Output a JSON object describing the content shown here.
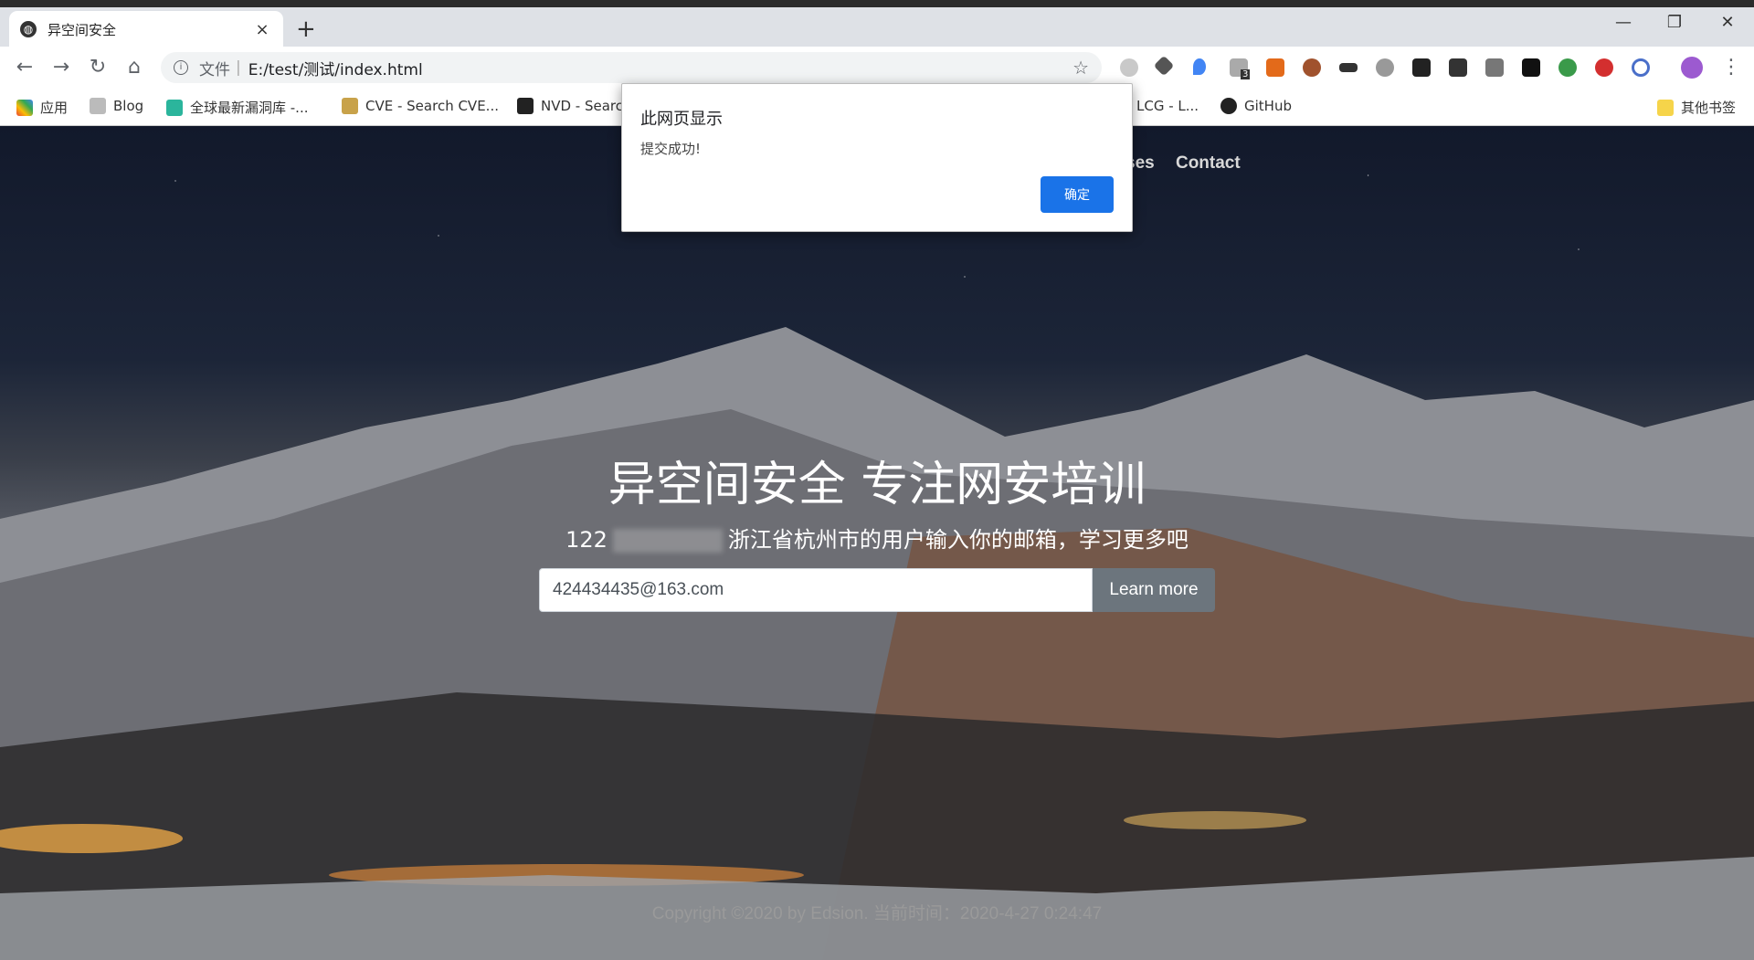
{
  "browser": {
    "tab_title": "异空间安全",
    "url_scheme": "文件",
    "url": "E:/test/测试/index.html",
    "extension_badge": "3",
    "bookmarks": [
      "应用",
      "Blog",
      "全球最新漏洞库 -...",
      "CVE - Search CVE...",
      "NVD - Searc",
      "LCG - L...",
      "GitHub",
      "其他书签"
    ]
  },
  "page": {
    "nav_partial": [
      "ses",
      "Contact"
    ],
    "hero_title": "异空间安全 专注网安培训",
    "hero_sub_prefix": "122",
    "hero_sub_suffix": "浙江省杭州市的用户输入你的邮箱，学习更多吧",
    "email_value": "424434435@163.com",
    "learn_more": "Learn more",
    "footer": "Copyright ©2020 by Edsion. 当前时间：2020-4-27 0:24:47"
  },
  "dialog": {
    "title": "此网页显示",
    "message": "提交成功!",
    "ok_label": "确定"
  }
}
